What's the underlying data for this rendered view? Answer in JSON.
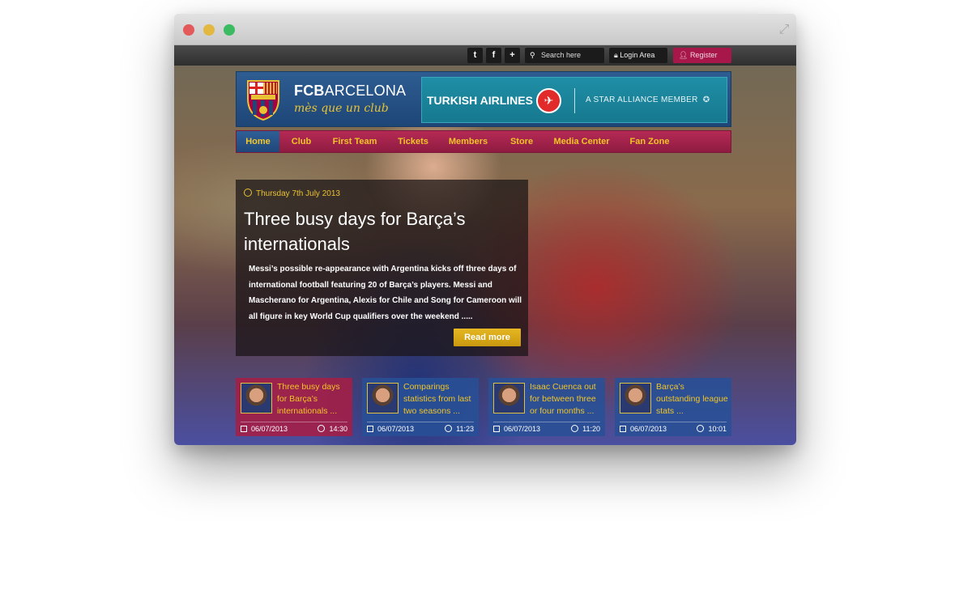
{
  "topbar": {
    "social": [
      {
        "icon": "twitter-icon",
        "glyph": "t"
      },
      {
        "icon": "facebook-icon",
        "glyph": "f"
      },
      {
        "icon": "plus-icon",
        "glyph": "+"
      }
    ],
    "search_placeholder": "Search here",
    "login_label": "Login Area",
    "register_label": "Register"
  },
  "header": {
    "club_name_bold": "FCB",
    "club_name_rest": "ARCELONA",
    "motto": "mès que un club",
    "sponsor_name": "TURKISH AIRLINES",
    "sponsor_alliance": "A STAR ALLIANCE MEMBER"
  },
  "nav": {
    "items": [
      {
        "label": "Home",
        "active": true
      },
      {
        "label": "Club"
      },
      {
        "label": "First Team"
      },
      {
        "label": "Tickets"
      },
      {
        "label": "Members"
      },
      {
        "label": "Store"
      },
      {
        "label": "Media Center"
      },
      {
        "label": "Fan Zone"
      }
    ]
  },
  "hero": {
    "date": "Thursday 7th July 2013",
    "title": "Three busy days for Barça’s internationals",
    "text": "Messi’s possible re-appearance with Argentina kicks off three days of international football featuring 20 of Barça’s players. Messi and Mascherano for Argentina, Alexis for Chile and Song for Cameroon will all figure in key World Cup qualifiers over the weekend .....",
    "read_more": "Read more"
  },
  "news": [
    {
      "title": "Three busy days for Barça’s internationals ...",
      "date": "06/07/2013",
      "time": "14:30"
    },
    {
      "title": "Comparings statistics from last two seasons ...",
      "date": "06/07/2013",
      "time": "11:23"
    },
    {
      "title": "Isaac Cuenca out for between three or four months ...",
      "date": "06/07/2013",
      "time": "11:20"
    },
    {
      "title": "Barça’s outstanding league stats ...",
      "date": "06/07/2013",
      "time": "10:01"
    }
  ],
  "colors": {
    "accent_gold": "#f0c528",
    "blaugrana_blue": "#1e4677",
    "blaugrana_red": "#a8174a"
  }
}
